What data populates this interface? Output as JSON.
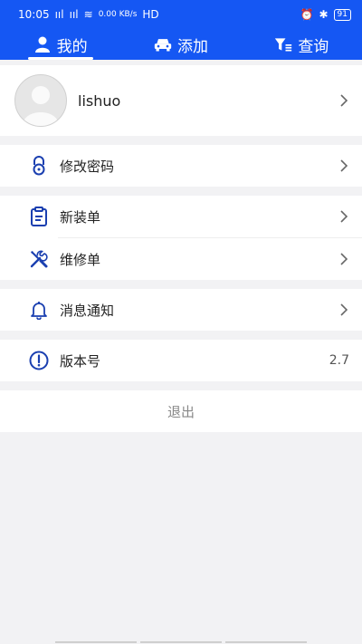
{
  "status": {
    "time": "10:05",
    "signal1": "ııl",
    "signal2": "ııl",
    "wifi": "≋",
    "speed": "0.00 KB/s",
    "hd": "HD",
    "battery": "91"
  },
  "tabs": [
    {
      "label": "我的",
      "icon": "person-icon"
    },
    {
      "label": "添加",
      "icon": "car-icon"
    },
    {
      "label": "查询",
      "icon": "filter-list-icon"
    }
  ],
  "profile": {
    "username": "lishuo"
  },
  "menu": {
    "change_password": "修改密码",
    "new_install": "新装单",
    "repair": "维修单",
    "notifications": "消息通知",
    "version_label": "版本号",
    "version_value": "2.7"
  },
  "logout": "退出",
  "colors": {
    "accent": "#1557f3",
    "icon_blue": "#1a3fb0"
  }
}
